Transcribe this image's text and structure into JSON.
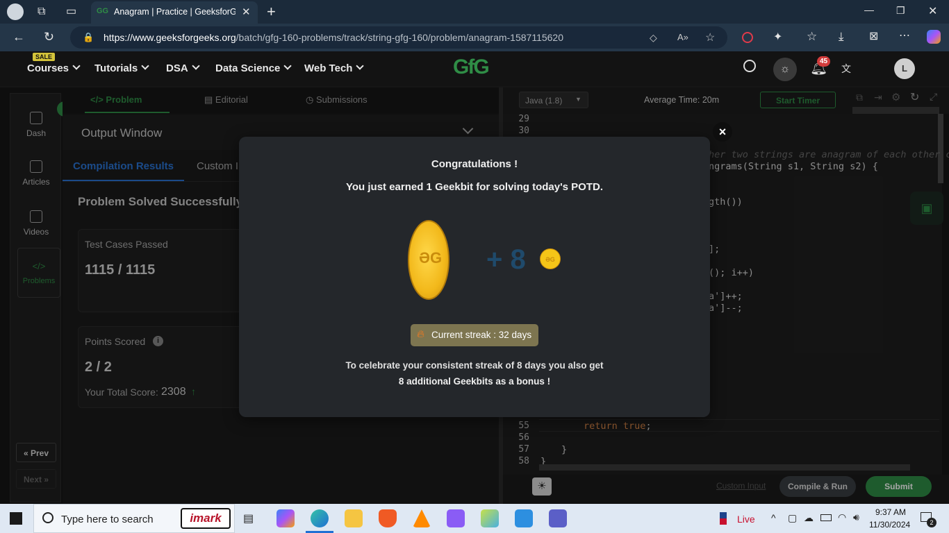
{
  "browser": {
    "tab_title": "Anagram | Practice | GeeksforGee",
    "url_domain": "https://www.geeksforgeeks.org",
    "url_path": "/batch/gfg-160-problems/track/string-gfg-160/problem/anagram-1587115620",
    "new_tab": "+"
  },
  "site_nav": {
    "sale_badge": "SALE",
    "items": [
      "Courses",
      "Tutorials",
      "DSA",
      "Data Science",
      "Web Tech"
    ],
    "logo": "GfG",
    "notification_count": "45",
    "avatar_letter": "L"
  },
  "sidebar": {
    "items": [
      "Dash",
      "Articles",
      "Videos",
      "Problems"
    ],
    "prev": "« Prev",
    "next": "Next »"
  },
  "problem_tabs": [
    "Problem",
    "Editorial",
    "Submissions"
  ],
  "output": {
    "title": "Output Window",
    "tabs": [
      "Compilation Results",
      "Custom I"
    ],
    "status": "Problem Solved Successfully",
    "test_cases_label": "Test Cases Passed",
    "test_cases_value": "1115 / 1115",
    "points_label": "Points Scored",
    "points_value": "2 / 2",
    "total_score_label": "Your Total Score:",
    "total_score_value": "2308"
  },
  "editor": {
    "language": "Java (1.8)",
    "average_time": "Average Time: 20m",
    "start_timer": "Start Timer",
    "line_numbers_top": [
      "29",
      "30"
    ],
    "line_numbers_bottom": [
      "55",
      "56",
      "57",
      "58"
    ],
    "code_fragments": {
      "comment": "her two strings are anagram of each other c",
      "signature_a": "ngrams(String s1, String s2) {",
      "length": "gth())",
      "array": "];",
      "loop": "(); i++)",
      "inc": "a']++;",
      "dec": "a']--;",
      "ret_kw": "return",
      "ret_val": "true",
      "ret_semi": ";",
      "close1": "}",
      "close2": "}"
    },
    "custom_input": "Custom Input",
    "compile_run": "Compile & Run",
    "submit": "Submit"
  },
  "modal": {
    "title": "Congratulations !",
    "subtitle": "You just earned 1 Geekbit for solving today's POTD.",
    "plus_label": "+ 8",
    "streak": "Current streak : 32 days",
    "bonus_line1": "To celebrate your consistent streak of 8 days you also get",
    "bonus_line2": "8 additional Geekbits as a bonus !",
    "close": "×"
  },
  "taskbar": {
    "search_placeholder": "Type here to search",
    "imark": "imark",
    "live": "Live",
    "time": "9:37 AM",
    "date": "11/30/2024",
    "notifications": "2"
  },
  "colors": {
    "gfg_green": "#2f8d46",
    "coin_gold": "#f5c518",
    "streak_bg": "#7d7550",
    "submit_green": "#2f8d46"
  }
}
